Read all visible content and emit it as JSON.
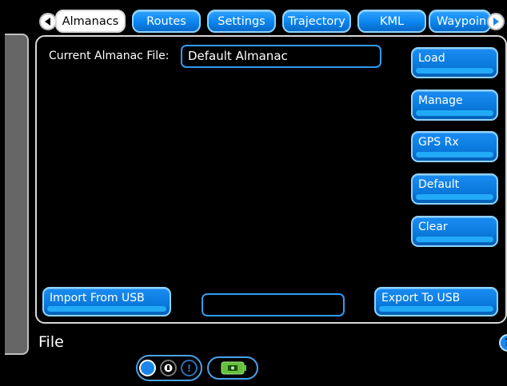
{
  "tabs": [
    {
      "label": "Almanacs",
      "active": true
    },
    {
      "label": "Routes",
      "active": false
    },
    {
      "label": "Settings",
      "active": false
    },
    {
      "label": "Trajectory",
      "active": false
    },
    {
      "label": "KML",
      "active": false
    },
    {
      "label": "Waypoin",
      "active": false
    }
  ],
  "almanac": {
    "current_label": "Current Almanac File:",
    "current_value": "Default Almanac"
  },
  "buttons": {
    "load": "Load",
    "manage": "Manage",
    "gps_rx": "GPS Rx",
    "default": "Default",
    "clear": "Clear",
    "import_usb": "Import From USB",
    "export_usb": "Export To USB"
  },
  "footer": {
    "title": "File",
    "help_glyph": "?"
  },
  "icons": {
    "nav_left": "left-arrow-icon",
    "nav_right": "right-arrow-icon",
    "help": "help-icon",
    "lock": "lock-icon",
    "alert": "alert-icon",
    "battery": "battery-icon"
  },
  "colors": {
    "accent_blue": "#0a84ef",
    "highlight_blue": "#22aaf8",
    "battery_green": "#63c23c"
  }
}
